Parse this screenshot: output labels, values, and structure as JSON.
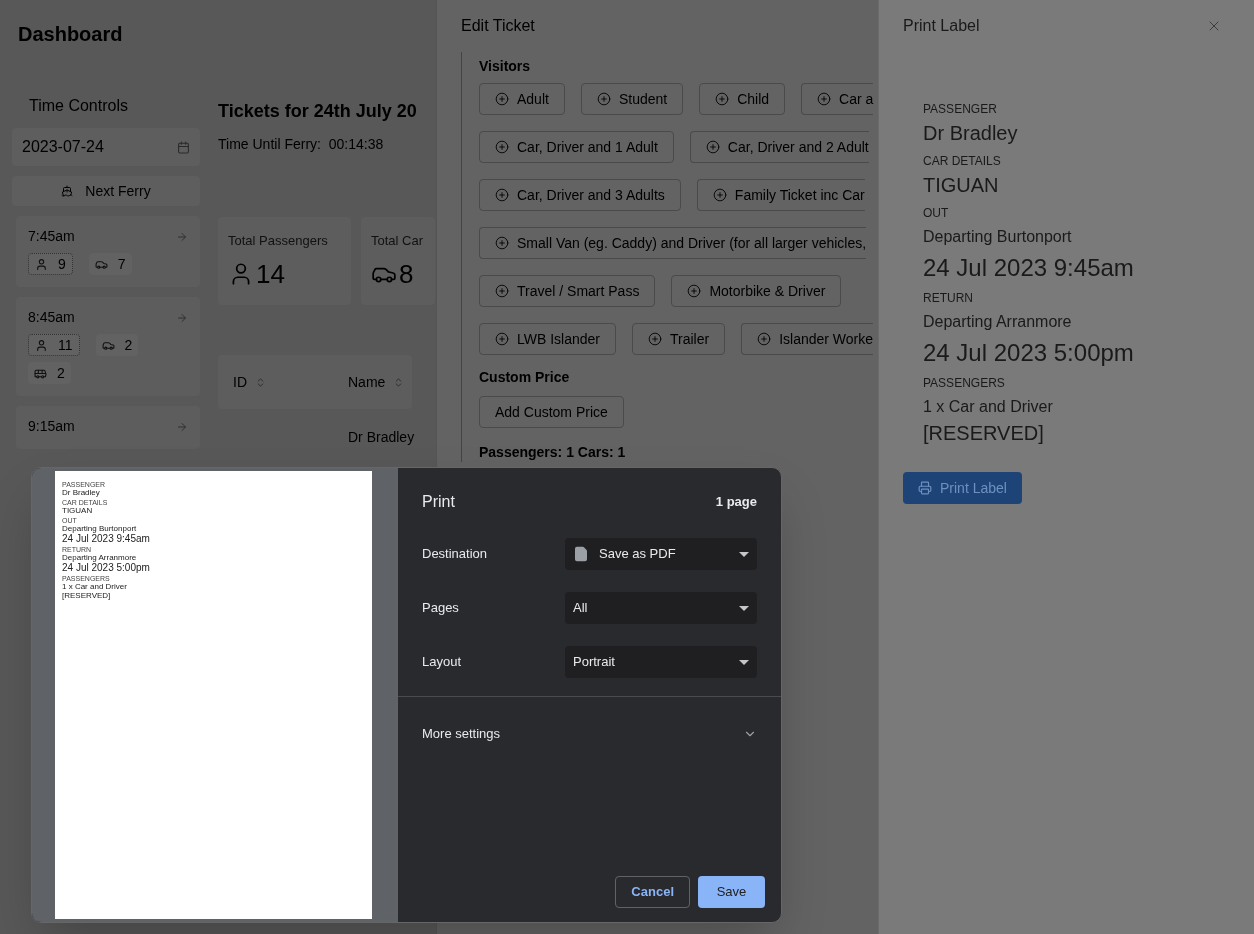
{
  "dashboard": {
    "title": "Dashboard",
    "time_controls": {
      "title": "Time Controls",
      "date": "2023-07-24",
      "next_ferry": "Next Ferry",
      "ferries": [
        {
          "time": "7:45am",
          "counts": [
            {
              "kind": "passengers",
              "value": "9"
            },
            {
              "kind": "cars",
              "value": "7"
            }
          ]
        },
        {
          "time": "8:45am",
          "counts": [
            {
              "kind": "passengers",
              "value": "11"
            },
            {
              "kind": "cars",
              "value": "2"
            },
            {
              "kind": "vans",
              "value": "2"
            }
          ]
        },
        {
          "time": "9:15am"
        }
      ]
    },
    "tickets_title": "Tickets for 24th July 20",
    "countdown_label": "Time Until Ferry:",
    "countdown": "00:14:38",
    "stats": [
      {
        "kind": "passengers",
        "label": "Total Passengers",
        "value": "14"
      },
      {
        "kind": "cars",
        "label": "Total Car",
        "value": "8"
      }
    ],
    "table": {
      "columns": [
        "ID",
        "Name"
      ],
      "rows": [
        [
          "",
          "Dr Bradley"
        ]
      ]
    }
  },
  "edit_ticket": {
    "title": "Edit Ticket",
    "visitors_title": "Visitors",
    "visitor_rows": [
      {
        "cut_off": true,
        "buttons": [
          "Adult",
          "Student",
          "Child",
          "Car a"
        ]
      },
      {
        "cut_off": true,
        "buttons": [
          "Car, Driver and 1 Adult",
          "Car, Driver and 2 Adult"
        ]
      },
      {
        "cut_off": true,
        "buttons": [
          "Car, Driver and 3 Adults",
          "Family Ticket inc Car"
        ]
      },
      {
        "cut_off": true,
        "buttons": [
          "Small Van (eg. Caddy) and Driver (for all larger vehicles,"
        ]
      },
      {
        "cut_off": false,
        "buttons": [
          "Travel / Smart Pass",
          "Motorbike & Driver"
        ]
      },
      {
        "cut_off": true,
        "buttons": [
          "LWB Islander",
          "Trailer",
          "Islander Worke"
        ]
      }
    ],
    "custom_price_title": "Custom Price",
    "custom_price_button": "Add Custom Price",
    "summary": "Passengers: 1 Cars: 1"
  },
  "print_label": {
    "title": "Print Label",
    "fields": [
      {
        "kind": "label",
        "text": "PASSENGER"
      },
      {
        "kind": "name",
        "text": "Dr Bradley"
      },
      {
        "kind": "label",
        "text": "CAR DETAILS"
      },
      {
        "kind": "name",
        "text": "TIGUAN"
      },
      {
        "kind": "label",
        "text": "OUT"
      },
      {
        "kind": "detail",
        "text": "Departing Burtonport"
      },
      {
        "kind": "date",
        "text": "24 Jul 2023 9:45am"
      },
      {
        "kind": "label",
        "text": "RETURN"
      },
      {
        "kind": "detail",
        "text": "Departing Arranmore"
      },
      {
        "kind": "date",
        "text": "24 Jul 2023 5:00pm"
      },
      {
        "kind": "label",
        "text": "PASSENGERS"
      },
      {
        "kind": "detail",
        "text": "1 x Car and Driver"
      },
      {
        "kind": "name",
        "text": "[RESERVED]"
      }
    ],
    "button": "Print Label"
  },
  "print_dialog": {
    "title": "Print",
    "page_count": "1 page",
    "preview": [
      {
        "kind": "label",
        "text": "PASSENGER"
      },
      {
        "kind": "detail",
        "text": "Dr Bradley"
      },
      {
        "kind": "label",
        "text": "CAR DETAILS"
      },
      {
        "kind": "detail",
        "text": "TIGUAN"
      },
      {
        "kind": "label",
        "text": "OUT"
      },
      {
        "kind": "detail",
        "text": "Departing Burtonport"
      },
      {
        "kind": "date",
        "text": "24 Jul 2023 9:45am"
      },
      {
        "kind": "label",
        "text": "RETURN"
      },
      {
        "kind": "detail",
        "text": "Departing Arranmore"
      },
      {
        "kind": "date",
        "text": "24 Jul 2023 5:00pm"
      },
      {
        "kind": "label",
        "text": "PASSENGERS"
      },
      {
        "kind": "detail",
        "text": "1 x Car and Driver"
      },
      {
        "kind": "detail",
        "text": "[RESERVED]"
      }
    ],
    "settings": [
      {
        "label": "Destination",
        "value": "Save as PDF",
        "kind": "file"
      },
      {
        "label": "Pages",
        "value": "All",
        "kind": "plain"
      },
      {
        "label": "Layout",
        "value": "Portrait",
        "kind": "plain"
      }
    ],
    "more_settings": "More settings",
    "more_expanded": false,
    "cancel": "Cancel",
    "save": "Save"
  }
}
